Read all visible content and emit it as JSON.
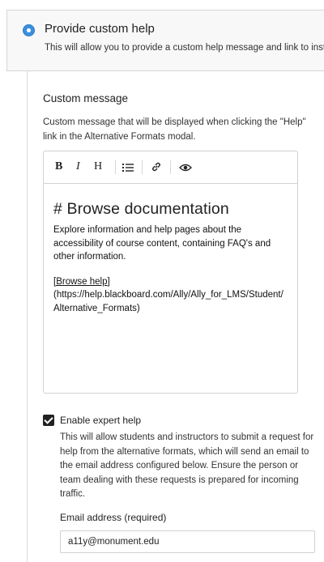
{
  "option": {
    "title": "Provide custom help",
    "description": "This will allow you to provide a custom help message and link to inst"
  },
  "custom_message": {
    "title": "Custom message",
    "description": "Custom message that will be displayed when clicking the \"Help\" link in the Alternative Formats modal."
  },
  "editor": {
    "toolbar": {
      "bold": "B",
      "italic": "I",
      "heading": "H",
      "list_icon": "bulleted-list-icon",
      "link_icon": "link-icon",
      "preview_icon": "eye-icon"
    },
    "heading": "# Browse documentation",
    "paragraph": "Explore information and help pages about the accessibility of course content, containing FAQ's and other information.",
    "link_text": "[Browse help]",
    "link_url": "(https://help.blackboard.com/Ally/Ally_for_LMS/Student/Alternative_Formats)"
  },
  "expert_help": {
    "label": "Enable expert help",
    "checked": true,
    "description": "This will allow students and instructors to submit a request for help from the alternative formats, which will send an email to the email address configured below. Ensure the person or team dealing with these requests is prepared for incoming traffic."
  },
  "email": {
    "label": "Email address (required)",
    "value": "a11y@monument.edu"
  },
  "colors": {
    "accent": "#3b8fde"
  }
}
